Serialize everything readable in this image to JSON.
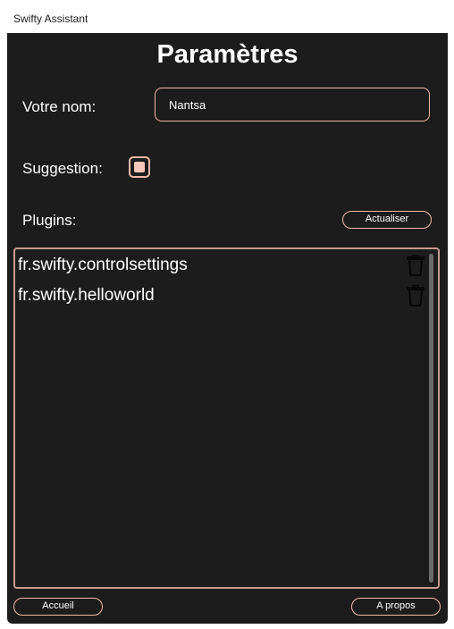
{
  "window": {
    "title": "Swifty Assistant"
  },
  "header": {
    "title": "Paramètres"
  },
  "settings": {
    "name_label": "Votre nom:",
    "name_value": "Nantsa",
    "suggestion_label": "Suggestion:",
    "suggestion_checked": true,
    "plugins_label": "Plugins:",
    "refresh_button": "Actualiser"
  },
  "plugins": {
    "items": [
      {
        "name": "fr.swifty.controlsettings",
        "icon": "trash-icon"
      },
      {
        "name": "fr.swifty.helloworld",
        "icon": "trash-icon"
      }
    ]
  },
  "footer": {
    "home_button": "Accueil",
    "about_button": "A propos"
  },
  "colors": {
    "background": "#1c1c1c",
    "accent": "#f2b8a8",
    "list_border": "#c89a94",
    "text": "#ffffff"
  }
}
